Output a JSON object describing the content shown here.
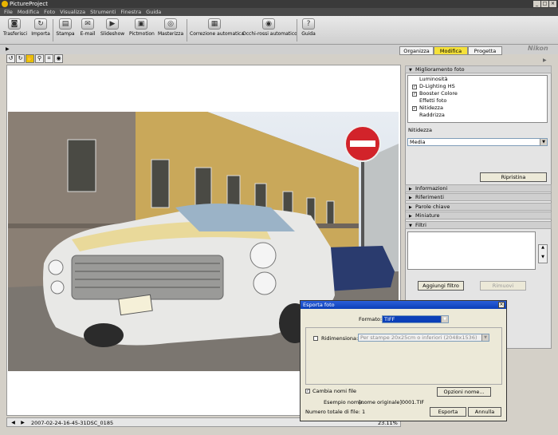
{
  "window": {
    "title": "PictureProject"
  },
  "menu": [
    "File",
    "Modifica",
    "Foto",
    "Visualizza",
    "Strumenti",
    "Finestra",
    "Guida"
  ],
  "toolbar": [
    {
      "label": "Trasferisci",
      "icon": "camera-icon"
    },
    {
      "label": "Importa",
      "icon": "import-icon"
    },
    {
      "label": "Stampa",
      "icon": "printer-icon"
    },
    {
      "label": "E-mail",
      "icon": "email-icon"
    },
    {
      "label": "Slideshow",
      "icon": "slideshow-icon"
    },
    {
      "label": "Pictmotion",
      "icon": "pictmotion-icon"
    },
    {
      "label": "Masterizza",
      "icon": "burn-disc-icon"
    },
    {
      "label": "Correzione automatica",
      "icon": "auto-correct-icon"
    },
    {
      "label": "Occhi-rossi automatico",
      "icon": "red-eye-icon"
    },
    {
      "label": "Guida",
      "icon": "help-icon"
    }
  ],
  "mode_tabs": [
    {
      "label": "Organizza",
      "active": false
    },
    {
      "label": "Modifica",
      "active": true
    },
    {
      "label": "Progetta",
      "active": false
    }
  ],
  "brand": "Nikon",
  "viewer": {
    "filename": "2007-02-24-16-45-31DSC_0185",
    "zoom": "23.11%"
  },
  "panel": {
    "enhance_title": "Miglioramento foto",
    "enhance_items": [
      {
        "label": "Luminosità",
        "checked": false
      },
      {
        "label": "D-Lighting HS",
        "checked": true
      },
      {
        "label": "Booster Colore",
        "checked": true
      },
      {
        "label": "Effetti foto",
        "checked": false
      },
      {
        "label": "Nitidezza",
        "checked": true
      },
      {
        "label": "Raddrizza",
        "checked": false
      }
    ],
    "sharpness_label": "Nitidezza",
    "sharpness_value": "Media",
    "reset_button": "Ripristina",
    "sections": [
      "Informazioni",
      "Riferimenti",
      "Parole chiave",
      "Miniature"
    ],
    "filters_title": "Filtri",
    "add_filter_button": "Aggiungi filtro",
    "remove_button": "Rimuovi"
  },
  "dialog": {
    "title": "Esporta foto",
    "format_label": "Formato:",
    "format_value": "TIFF",
    "resize_label": "Ridimensiona:",
    "resize_checked": false,
    "resize_value": "Per stampe 20x25cm o inferiori (2048x1536)",
    "rename_label": "Cambia nomi file",
    "rename_checked": true,
    "options_button": "Opzioni nome...",
    "example_label": "Esempio nome:",
    "example_value": "[nome originale]0001.TIF",
    "count_label": "Numero totale di file: 1",
    "export_button": "Esporta",
    "cancel_button": "Annulla"
  }
}
